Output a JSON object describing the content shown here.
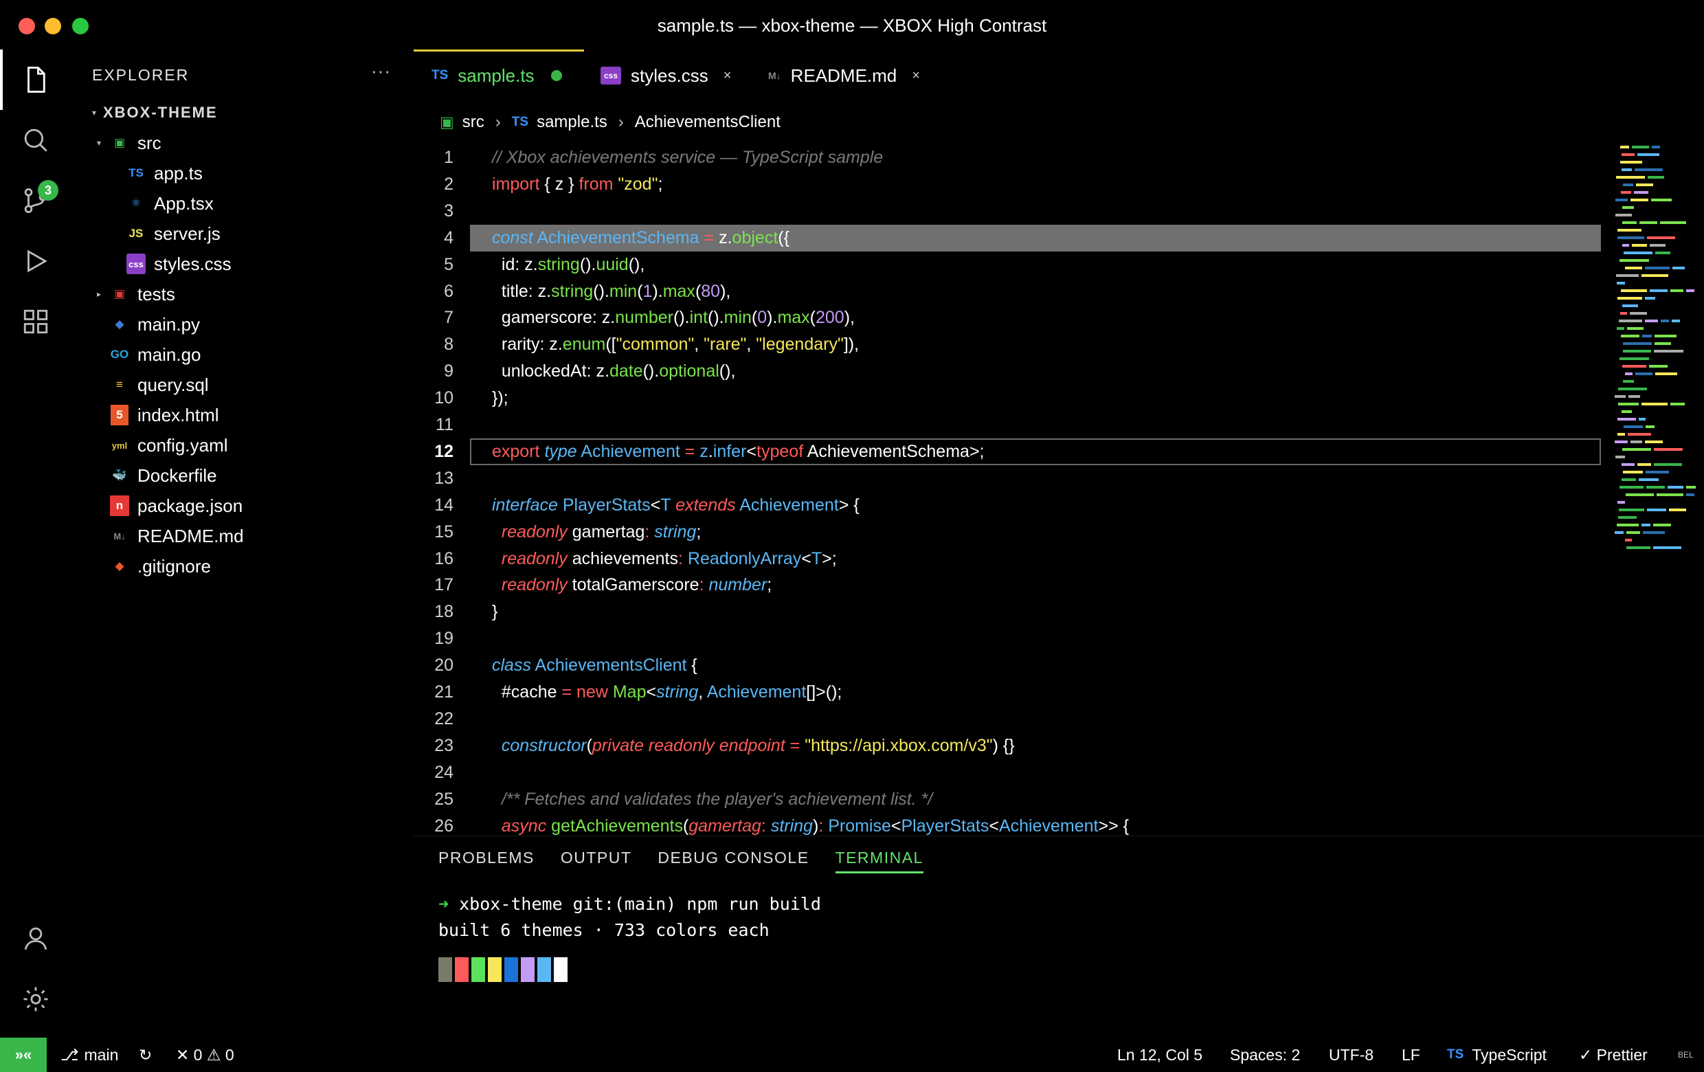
{
  "window": {
    "title": "sample.ts — xbox-theme — XBOX High Contrast"
  },
  "activity_bar": {
    "scm_badge": "3"
  },
  "sidebar": {
    "header": "EXPLORER",
    "more": "···",
    "root": "XBOX-THEME",
    "items": [
      {
        "label": "src",
        "icon": "folder-src-icon",
        "glyph": "▣",
        "color": "#38b64a"
      },
      {
        "label": "app.ts",
        "icon": "typescript-file-icon",
        "glyph": "TS",
        "color": "#3794ff"
      },
      {
        "label": "App.tsx",
        "icon": "react-file-icon",
        "glyph": "⚛",
        "color": "#3794ff"
      },
      {
        "label": "server.js",
        "icon": "javascript-file-icon",
        "glyph": "JS",
        "color": "#f6e85a"
      },
      {
        "label": "styles.css",
        "icon": "css-file-icon",
        "glyph": "css",
        "color": "#8a3fc6"
      },
      {
        "label": "tests",
        "icon": "folder-tests-icon",
        "glyph": "▣",
        "color": "#e53935"
      },
      {
        "label": "main.py",
        "icon": "python-file-icon",
        "glyph": "◆",
        "color": "#3e7bd6"
      },
      {
        "label": "main.go",
        "icon": "go-file-icon",
        "glyph": "GO",
        "color": "#2aa6e0"
      },
      {
        "label": "query.sql",
        "icon": "database-file-icon",
        "glyph": "≡",
        "color": "#f6c92b"
      },
      {
        "label": "index.html",
        "icon": "html-file-icon",
        "glyph": "5",
        "color": "#e8572a"
      },
      {
        "label": "config.yaml",
        "icon": "yaml-file-icon",
        "glyph": "yml",
        "color": "#e8c93c"
      },
      {
        "label": "Dockerfile",
        "icon": "docker-file-icon",
        "glyph": "🐳",
        "color": "#2496ed"
      },
      {
        "label": "package.json",
        "icon": "npm-file-icon",
        "glyph": "n",
        "color": "#e53935"
      },
      {
        "label": "README.md",
        "icon": "markdown-file-icon",
        "glyph": "M↓",
        "color": "#8a8a8a"
      },
      {
        "label": ".gitignore",
        "icon": "git-file-icon",
        "glyph": "◆",
        "color": "#e8572a"
      }
    ]
  },
  "tabs": [
    {
      "label": "sample.ts",
      "lang": "TS",
      "lang_color": "#3794ff",
      "state": "modified"
    },
    {
      "label": "styles.css",
      "lang": "css",
      "lang_color": "#8a3fc6",
      "state": "close"
    },
    {
      "label": "README.md",
      "lang": "M↓",
      "lang_color": "#8a8a8a",
      "state": "close"
    }
  ],
  "breadcrumbs": {
    "folder": "src",
    "lang": "TS",
    "file": "sample.ts",
    "symbol": "AchievementsClient",
    "sep": "›"
  },
  "code": {
    "current_line": 12,
    "selected_line": 4,
    "lines": [
      [
        [
          "cmt",
          "// Xbox achievements service — TypeScript sample"
        ]
      ],
      [
        [
          "kw",
          "import"
        ],
        [
          "pu",
          " { z } "
        ],
        [
          "kw",
          "from"
        ],
        [
          "pu",
          " "
        ],
        [
          "st",
          "\"zod\""
        ],
        [
          "pu",
          ";"
        ]
      ],
      [],
      [
        [
          "it",
          "const"
        ],
        [
          "pu",
          " "
        ],
        [
          "ty",
          "AchievementSchema"
        ],
        [
          "pu",
          " "
        ],
        [
          "op",
          "="
        ],
        [
          "pu",
          " z."
        ],
        [
          "fn",
          "object"
        ],
        [
          "pu",
          "({"
        ]
      ],
      [
        [
          "pu",
          "  id: z."
        ],
        [
          "fn",
          "string"
        ],
        [
          "pu",
          "()."
        ],
        [
          "fn",
          "uuid"
        ],
        [
          "pu",
          "(),"
        ]
      ],
      [
        [
          "pu",
          "  title: z."
        ],
        [
          "fn",
          "string"
        ],
        [
          "pu",
          "()."
        ],
        [
          "fn",
          "min"
        ],
        [
          "pu",
          "("
        ],
        [
          "nu",
          "1"
        ],
        [
          "pu",
          ")."
        ],
        [
          "fn",
          "max"
        ],
        [
          "pu",
          "("
        ],
        [
          "nu",
          "80"
        ],
        [
          "pu",
          "),"
        ]
      ],
      [
        [
          "pu",
          "  gamerscore: z."
        ],
        [
          "fn",
          "number"
        ],
        [
          "pu",
          "()."
        ],
        [
          "fn",
          "int"
        ],
        [
          "pu",
          "()."
        ],
        [
          "fn",
          "min"
        ],
        [
          "pu",
          "("
        ],
        [
          "nu",
          "0"
        ],
        [
          "pu",
          ")."
        ],
        [
          "fn",
          "max"
        ],
        [
          "pu",
          "("
        ],
        [
          "nu",
          "200"
        ],
        [
          "pu",
          "),"
        ]
      ],
      [
        [
          "pu",
          "  rarity: z."
        ],
        [
          "fn",
          "enum"
        ],
        [
          "pu",
          "(["
        ],
        [
          "st",
          "\"common\""
        ],
        [
          "pu",
          ", "
        ],
        [
          "st",
          "\"rare\""
        ],
        [
          "pu",
          ", "
        ],
        [
          "st",
          "\"legendary\""
        ],
        [
          "pu",
          "]),"
        ]
      ],
      [
        [
          "pu",
          "  unlockedAt: z."
        ],
        [
          "fn",
          "date"
        ],
        [
          "pu",
          "()."
        ],
        [
          "fn",
          "optional"
        ],
        [
          "pu",
          "(),"
        ]
      ],
      [
        [
          "pu",
          "});"
        ]
      ],
      [],
      [
        [
          "kw",
          "export"
        ],
        [
          "pu",
          " "
        ],
        [
          "it",
          "type"
        ],
        [
          "pu",
          " "
        ],
        [
          "ty",
          "Achievement"
        ],
        [
          "pu",
          " "
        ],
        [
          "op",
          "="
        ],
        [
          "pu",
          " "
        ],
        [
          "ty",
          "z"
        ],
        [
          "pu",
          "."
        ],
        [
          "ty",
          "infer"
        ],
        [
          "pu",
          "<"
        ],
        [
          "kw",
          "typeof"
        ],
        [
          "pu",
          " AchievementSchema>;"
        ]
      ],
      [],
      [
        [
          "it",
          "interface"
        ],
        [
          "pu",
          " "
        ],
        [
          "ty",
          "PlayerStats"
        ],
        [
          "pu",
          "<"
        ],
        [
          "ty",
          "T"
        ],
        [
          "pu",
          " "
        ],
        [
          "kwi",
          "extends"
        ],
        [
          "pu",
          " "
        ],
        [
          "ty",
          "Achievement"
        ],
        [
          "pu",
          "> {"
        ]
      ],
      [
        [
          "pu",
          "  "
        ],
        [
          "kwi",
          "readonly"
        ],
        [
          "pu",
          " gamertag"
        ],
        [
          "op",
          ":"
        ],
        [
          "pu",
          " "
        ],
        [
          "it",
          "string"
        ],
        [
          "pu",
          ";"
        ]
      ],
      [
        [
          "pu",
          "  "
        ],
        [
          "kwi",
          "readonly"
        ],
        [
          "pu",
          " achievements"
        ],
        [
          "op",
          ":"
        ],
        [
          "pu",
          " "
        ],
        [
          "ty",
          "ReadonlyArray"
        ],
        [
          "pu",
          "<"
        ],
        [
          "ty",
          "T"
        ],
        [
          "pu",
          ">;"
        ]
      ],
      [
        [
          "pu",
          "  "
        ],
        [
          "kwi",
          "readonly"
        ],
        [
          "pu",
          " totalGamerscore"
        ],
        [
          "op",
          ":"
        ],
        [
          "pu",
          " "
        ],
        [
          "it",
          "number"
        ],
        [
          "pu",
          ";"
        ]
      ],
      [
        [
          "pu",
          "}"
        ]
      ],
      [],
      [
        [
          "it",
          "class"
        ],
        [
          "pu",
          " "
        ],
        [
          "ty",
          "AchievementsClient"
        ],
        [
          "pu",
          " {"
        ]
      ],
      [
        [
          "pu",
          "  #cache "
        ],
        [
          "op",
          "="
        ],
        [
          "pu",
          " "
        ],
        [
          "kw",
          "new"
        ],
        [
          "pu",
          " "
        ],
        [
          "fn",
          "Map"
        ],
        [
          "pu",
          "<"
        ],
        [
          "it",
          "string"
        ],
        [
          "pu",
          ", "
        ],
        [
          "ty",
          "Achievement"
        ],
        [
          "pu",
          "[]>();"
        ]
      ],
      [],
      [
        [
          "pu",
          "  "
        ],
        [
          "it",
          "constructor"
        ],
        [
          "pu",
          "("
        ],
        [
          "kwi",
          "private"
        ],
        [
          "pu",
          " "
        ],
        [
          "kwi",
          "readonly"
        ],
        [
          "pu",
          " "
        ],
        [
          "kwi",
          "endpoint"
        ],
        [
          "pu",
          " "
        ],
        [
          "op",
          "="
        ],
        [
          "pu",
          " "
        ],
        [
          "st",
          "\"https://api.xbox.com/v3\""
        ],
        [
          "pu",
          ") {}"
        ]
      ],
      [],
      [
        [
          "pu",
          "  "
        ],
        [
          "cmt",
          "/** Fetches and validates the player's achievement list. */"
        ]
      ],
      [
        [
          "pu",
          "  "
        ],
        [
          "kwi",
          "async"
        ],
        [
          "pu",
          " "
        ],
        [
          "fn",
          "getAchievements"
        ],
        [
          "pu",
          "("
        ],
        [
          "kwi",
          "gamertag"
        ],
        [
          "op",
          ":"
        ],
        [
          "pu",
          " "
        ],
        [
          "it",
          "string"
        ],
        [
          "pu",
          ")"
        ],
        [
          "op",
          ":"
        ],
        [
          "pu",
          " "
        ],
        [
          "ty",
          "Promise"
        ],
        [
          "pu",
          "<"
        ],
        [
          "ty",
          "PlayerStats"
        ],
        [
          "pu",
          "<"
        ],
        [
          "ty",
          "Achievement"
        ],
        [
          "pu",
          ">> {"
        ]
      ]
    ]
  },
  "panel": {
    "tabs": [
      "PROBLEMS",
      "OUTPUT",
      "DEBUG CONSOLE",
      "TERMINAL"
    ],
    "active_tab": "TERMINAL",
    "terminal": {
      "arrow": "➜",
      "prompt": " xbox-theme git:(main) npm run build",
      "output": "built 6 themes · 733 colors each",
      "swatches": [
        "#7a7a6a",
        "#ff5a5a",
        "#5ae35a",
        "#f6e85a",
        "#1a73d9",
        "#c49cf5",
        "#5ab7f5",
        "#ffffff"
      ]
    }
  },
  "status": {
    "remote": "»«",
    "branch": "main",
    "sync": "↻",
    "problems": "✕ 0 ⚠ 0",
    "position": "Ln 12, Col 5",
    "spaces": "Spaces: 2",
    "encoding": "UTF-8",
    "eol": "LF",
    "language_glyph": "TS",
    "language": "TypeScript",
    "formatter": "✓ Prettier",
    "bell": "BEL"
  }
}
